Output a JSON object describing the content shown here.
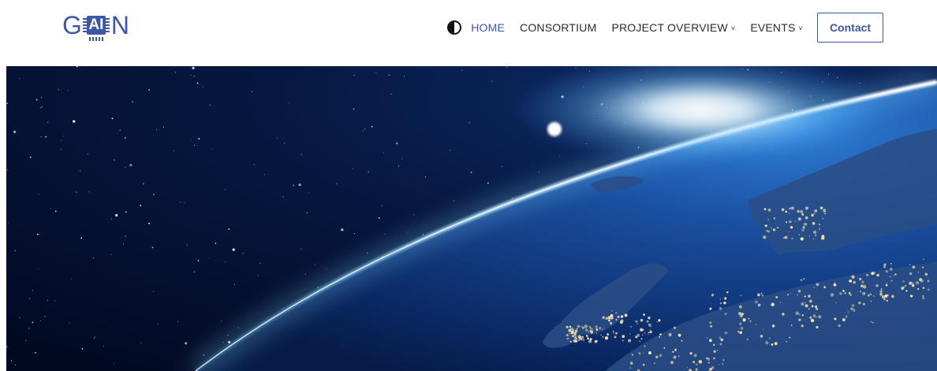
{
  "logo": {
    "text_left": "G",
    "text_chip": "AI",
    "text_right": "N",
    "brand_color": "#3f56a4"
  },
  "nav": {
    "theme_toggle_icon": "contrast-icon",
    "items": [
      {
        "label": "HOME",
        "active": true
      },
      {
        "label": "CONSORTIUM",
        "active": false
      },
      {
        "label": "PROJECT OVERVIEW",
        "has_dropdown": true
      },
      {
        "label": "EVENTS",
        "has_dropdown": true
      }
    ],
    "dropdown_icon": "˅",
    "contact_label": "Contact"
  },
  "hero": {
    "image": "earth-from-space-europe-night-lights",
    "colors": {
      "space": "#020a22",
      "glow": "#bfe9ff",
      "ocean": "#1a4fa0",
      "city_lights": "#ffe9b0"
    }
  }
}
